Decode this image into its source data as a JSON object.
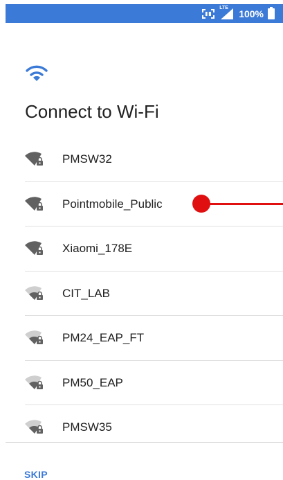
{
  "status_bar": {
    "network_label": "LTE",
    "battery_percent": "100%",
    "icons": [
      "scan-icon",
      "lte-signal-icon",
      "battery-icon"
    ],
    "background": "#3b7ad6"
  },
  "header": {
    "icon": "wifi-icon",
    "title": "Connect to Wi-Fi"
  },
  "networks": [
    {
      "ssid": "PMSW32",
      "signal": "strong",
      "secured": true
    },
    {
      "ssid": "Pointmobile_Public",
      "signal": "strong",
      "secured": true
    },
    {
      "ssid": "Xiaomi_178E",
      "signal": "strong",
      "secured": true
    },
    {
      "ssid": "CIT_LAB",
      "signal": "weak",
      "secured": true
    },
    {
      "ssid": "PM24_EAP_FT",
      "signal": "weak",
      "secured": true
    },
    {
      "ssid": "PM50_EAP",
      "signal": "weak",
      "secured": true
    },
    {
      "ssid": "PMSW35",
      "signal": "weak",
      "secured": true
    }
  ],
  "footer": {
    "skip_label": "SKIP"
  },
  "colors": {
    "accent": "#3b7ad6",
    "touch_indicator": "#e01010",
    "signal_strong": "#616161",
    "signal_weak": "#bdbdbd"
  }
}
